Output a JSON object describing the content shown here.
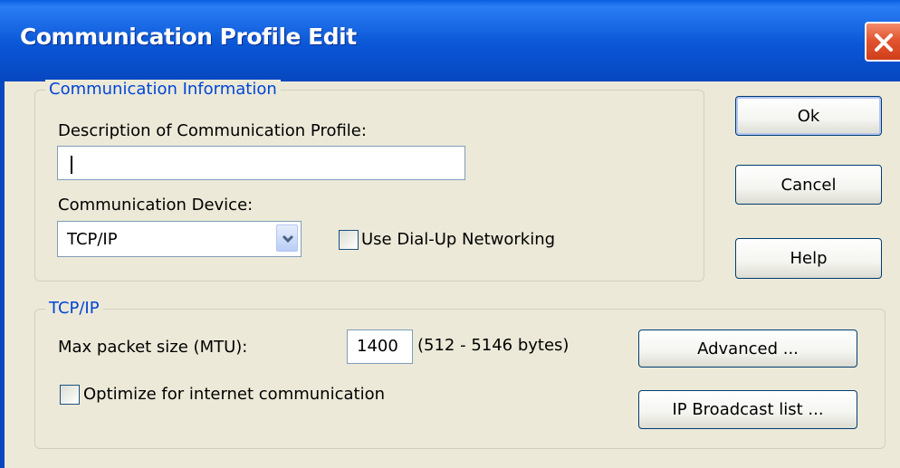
{
  "window": {
    "title": "Communication Profile Edit",
    "close_icon": "close-icon"
  },
  "comm_info": {
    "legend": "Communication Information",
    "description_label": "Description of Communication Profile:",
    "description_value": "",
    "device_label": "Communication Device:",
    "device_value": "TCP/IP",
    "dialup_label": "Use Dial-Up Networking",
    "dialup_checked": false
  },
  "buttons": {
    "ok": "Ok",
    "cancel": "Cancel",
    "help": "Help",
    "advanced": "Advanced ...",
    "broadcast": "IP Broadcast list ..."
  },
  "tcpip": {
    "legend": "TCP/IP",
    "mtu_label": "Max packet size (MTU):",
    "mtu_value": "1400",
    "mtu_range": "(512 - 5146 bytes)",
    "optimize_label": "Optimize for internet communication",
    "optimize_checked": false
  },
  "colors": {
    "titlebar": "#0a56d6",
    "close_button": "#e2552f",
    "legend_text": "#0046d5",
    "dialog_bg": "#ece9d8"
  }
}
